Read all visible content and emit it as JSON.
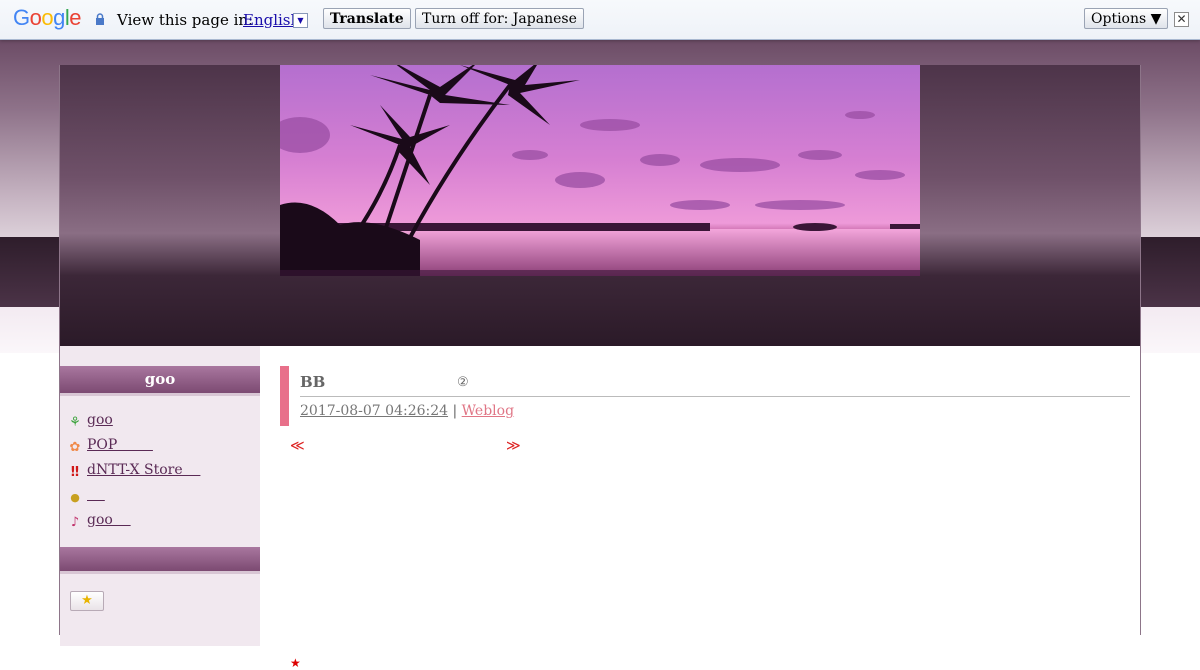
{
  "translate_bar": {
    "logo": "Google",
    "prompt": "View this page in:",
    "language": "English",
    "translate_label": "Translate",
    "turn_off_label": "Turn off for: Japanese",
    "options_label": "Options ▼",
    "close_glyph": "✕"
  },
  "sidebar": {
    "header_title": "goo",
    "items": [
      {
        "icon": "sprout-icon",
        "label": "goo"
      },
      {
        "icon": "flower-icon",
        "label": "POP        "
      },
      {
        "icon": "double-exclamation-icon",
        "label": "dNTT-X Store    "
      },
      {
        "icon": "acorn-icon",
        "label": "    "
      },
      {
        "icon": "music-note-icon",
        "label": "goo    "
      }
    ],
    "star_button": "★"
  },
  "entry": {
    "title": "BB",
    "title_mark": "②",
    "date": "2017-08-07 04:26:24",
    "separator": "|",
    "category": "Weblog",
    "prev": "≪",
    "next": "≫",
    "star": "★"
  },
  "colors": {
    "accent_pink": "#e8708a",
    "sidebar_header": "#8d5a83",
    "frame_dark": "#2b1a28"
  }
}
